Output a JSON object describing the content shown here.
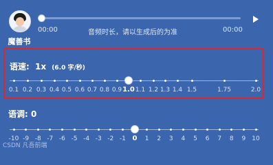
{
  "user": {
    "name": "魔善书"
  },
  "audio": {
    "time_start": "00:00",
    "time_end": "00:00",
    "note": "音频时长，请以生成后的为准",
    "progress": 0
  },
  "speed": {
    "label": "语速:",
    "value": "1x",
    "rate": "(6.0 字/秒)",
    "ticks": [
      "0.1",
      "0.2",
      "0.3",
      "0.4",
      "0.5",
      "0.6",
      "0.7",
      "0.8",
      "0.9",
      "1.0",
      "1.1",
      "1.2",
      "1.3",
      "1.4",
      "1.5",
      "1.75",
      "2.0"
    ],
    "selected": "1.0"
  },
  "pitch": {
    "label": "语调:",
    "value": "0",
    "ticks": [
      "-10",
      "-9",
      "-8",
      "-7",
      "-6",
      "-5",
      "-4",
      "-3",
      "-2",
      "-1",
      "0",
      "1",
      "2",
      "3",
      "4",
      "5",
      "6",
      "7",
      "8",
      "9",
      "10"
    ],
    "selected": "0"
  },
  "watermark": "CSDN 凡吾前端"
}
